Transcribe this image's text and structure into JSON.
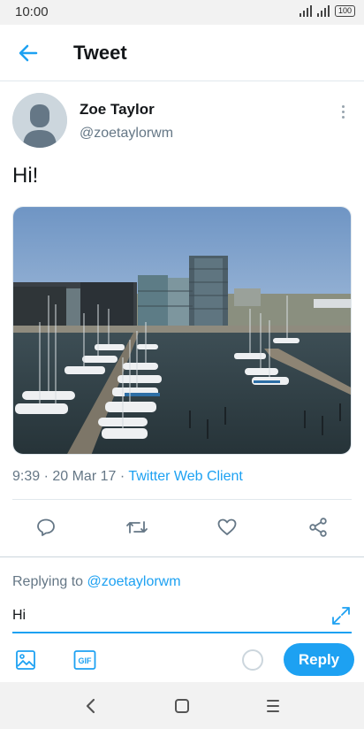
{
  "status_bar": {
    "time": "10:00",
    "signal_1_label": "R",
    "signal_2_label": "R",
    "battery": "100"
  },
  "header": {
    "back_icon": "arrow-left-icon",
    "title": "Tweet"
  },
  "tweet": {
    "author_name": "Zoe Taylor",
    "author_handle": "@zoetaylorwm",
    "avatar_icon": "default-avatar-icon",
    "more_icon": "more-vertical-icon",
    "text": "Hi!",
    "media_alt": "harbor-marina-photo",
    "timestamp": "9:39 · 20 Mar 17 · ",
    "source": "Twitter Web Client"
  },
  "actions": [
    {
      "name": "reply-action",
      "icon": "comment-icon"
    },
    {
      "name": "retweet-action",
      "icon": "retweet-icon"
    },
    {
      "name": "like-action",
      "icon": "heart-icon"
    },
    {
      "name": "share-action",
      "icon": "share-icon"
    }
  ],
  "composer": {
    "replying_prefix": "Replying to ",
    "replying_handle": "@zoetaylorwm",
    "input_value": "Hi",
    "expand_icon": "expand-icon",
    "image_icon": "image-icon",
    "gif_label": "GIF",
    "reply_label": "Reply"
  },
  "system_nav": {
    "back_icon": "nav-back-icon",
    "home_icon": "nav-home-icon",
    "menu_icon": "nav-menu-icon"
  },
  "colors": {
    "accent": "#1da1f2",
    "secondary_text": "#657786",
    "divider": "#e1e8ed"
  }
}
